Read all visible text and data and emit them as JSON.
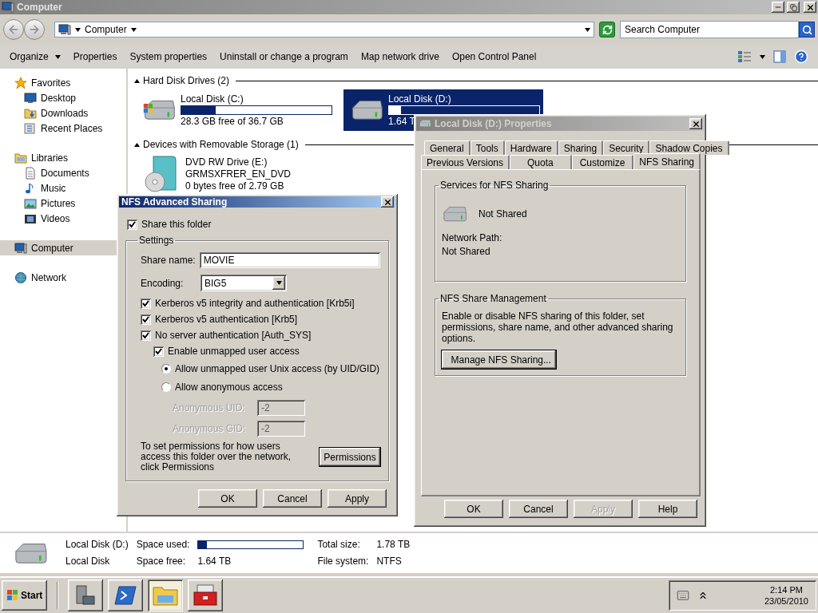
{
  "window": {
    "title": "Computer"
  },
  "address": {
    "path": "Computer"
  },
  "search": {
    "placeholder": "Search Computer"
  },
  "commands": [
    {
      "label": "Organize",
      "kind": "menu"
    },
    {
      "label": "Properties",
      "kind": "button"
    },
    {
      "label": "System properties",
      "kind": "button"
    },
    {
      "label": "Uninstall or change a program",
      "kind": "button"
    },
    {
      "label": "Map network drive",
      "kind": "button"
    },
    {
      "label": "Open Control Panel",
      "kind": "button"
    }
  ],
  "nav": [
    {
      "label": "Favorites",
      "kind": "star",
      "selected": false,
      "children": [
        {
          "label": "Desktop",
          "kind": "desktop",
          "selected": false
        },
        {
          "label": "Downloads",
          "kind": "downloads",
          "selected": false
        },
        {
          "label": "Recent Places",
          "kind": "recent",
          "selected": false
        }
      ]
    },
    {
      "label": "Libraries",
      "kind": "library",
      "selected": false,
      "children": [
        {
          "label": "Documents",
          "kind": "documents",
          "selected": false
        },
        {
          "label": "Music",
          "kind": "music",
          "selected": false
        },
        {
          "label": "Pictures",
          "kind": "pictures",
          "selected": false
        },
        {
          "label": "Videos",
          "kind": "videos",
          "selected": false
        }
      ]
    },
    {
      "label": "Computer",
      "kind": "computer",
      "selected": true
    },
    {
      "label": "Network",
      "kind": "network",
      "selected": false
    }
  ],
  "groups": [
    {
      "title": "Hard Disk Drives (2)",
      "expanded": true,
      "items": [
        {
          "name": "Local Disk (C:)",
          "kind": "system-disk",
          "selected": false,
          "level": 0.23,
          "lines": [
            "28.3 GB free of 36.7 GB"
          ]
        },
        {
          "name": "Local Disk (D:)",
          "kind": "disk",
          "selected": true,
          "level": 0.08,
          "lines": [
            "1.64 T"
          ]
        }
      ]
    },
    {
      "title": "Devices with Removable Storage (1)",
      "expanded": true,
      "items": [
        {
          "name": "DVD RW Drive (E:)",
          "kind": "dvd",
          "selected": false,
          "lines": [
            "GRMSXFRER_EN_DVD",
            "0 bytes free of 2.79 GB"
          ]
        }
      ]
    }
  ],
  "details": {
    "name": "Local Disk (D:)",
    "type": "Local Disk",
    "used_label": "Space used:",
    "level": 0.08,
    "free_label": "Space free:",
    "free": "1.64 TB",
    "total_label": "Total size:",
    "total": "1.78 TB",
    "fs_label": "File system:",
    "fs": "NTFS"
  },
  "taskbar": {
    "start": "Start",
    "apps": [
      {
        "kind": "server",
        "selected": false
      },
      {
        "kind": "shell",
        "selected": false
      },
      {
        "kind": "explorer",
        "selected": true
      },
      {
        "kind": "toolbox",
        "selected": false
      }
    ],
    "time": "2:14 PM",
    "date": "23/05/2010"
  },
  "nfs_dialog": {
    "title": "NFS Advanced Sharing",
    "active": true,
    "share_folder": {
      "label": "Share this folder",
      "checked": true
    },
    "settings_title": "Settings",
    "share_name": {
      "label": "Share name:",
      "value": "MOVIE"
    },
    "encoding": {
      "label": "Encoding:",
      "value": "BIG5"
    },
    "options": [
      {
        "label": "Kerberos v5 integrity and authentication [Krb5i]",
        "checked": true
      },
      {
        "label": "Kerberos v5 authentication [Krb5]",
        "checked": true
      },
      {
        "label": "No server authentication [Auth_SYS]",
        "checked": true
      }
    ],
    "unmapped": {
      "label": "Enable unmapped user access",
      "checked": true
    },
    "radios": [
      {
        "label": "Allow unmapped user Unix access (by UID/GID)",
        "selected": true
      },
      {
        "label": "Allow anonymous access",
        "selected": false
      }
    ],
    "anonymous_fields": [
      {
        "label": "Anonymous UID:",
        "value": "-2",
        "disabled": true
      },
      {
        "label": "Anonymous GID:",
        "value": "-2",
        "disabled": true
      }
    ],
    "permissions_note": "To set permissions for how users access this folder over the network, click Permissions",
    "permissions_button": "Permissions",
    "buttons": [
      {
        "label": "OK",
        "disabled": false
      },
      {
        "label": "Cancel",
        "disabled": false
      },
      {
        "label": "Apply",
        "disabled": false
      }
    ]
  },
  "properties_dialog": {
    "title": "Local Disk (D:) Properties",
    "active": false,
    "tab_rows": [
      [
        {
          "label": "General",
          "selected": false
        },
        {
          "label": "Tools",
          "selected": false
        },
        {
          "label": "Hardware",
          "selected": false
        },
        {
          "label": "Sharing",
          "selected": false
        },
        {
          "label": "Security",
          "selected": false
        },
        {
          "label": "Shadow Copies",
          "selected": false
        }
      ],
      [
        {
          "label": "Previous Versions",
          "selected": false
        },
        {
          "label": "Quota",
          "selected": false
        },
        {
          "label": "Customize",
          "selected": false
        },
        {
          "label": "NFS Sharing",
          "selected": true
        }
      ]
    ],
    "services": {
      "title": "Services for NFS Sharing",
      "status": "Not Shared",
      "path_label": "Network Path:",
      "path": "Not Shared"
    },
    "management": {
      "title": "NFS Share Management",
      "description": "Enable or disable NFS sharing of this folder, set permissions, share name, and other advanced sharing options.",
      "button": "Manage NFS Sharing..."
    },
    "buttons": [
      {
        "label": "OK",
        "disabled": false
      },
      {
        "label": "Cancel",
        "disabled": false
      },
      {
        "label": "Apply",
        "disabled": true
      },
      {
        "label": "Help",
        "disabled": false
      }
    ]
  }
}
